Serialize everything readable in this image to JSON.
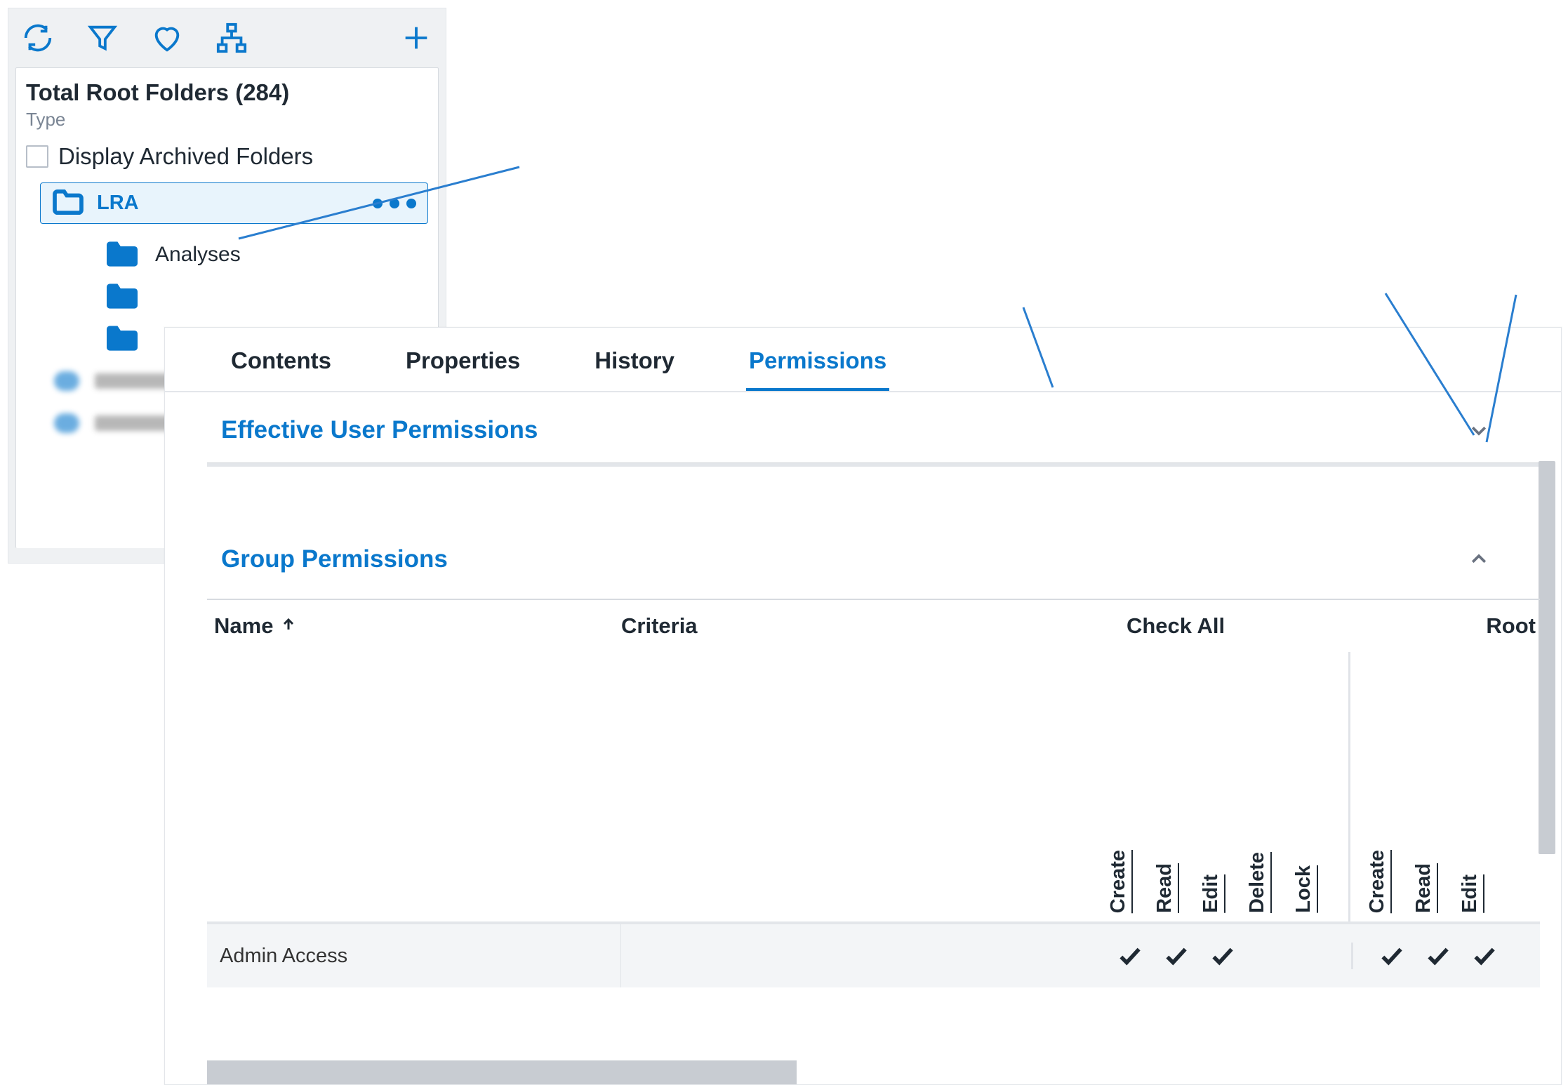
{
  "sidebar": {
    "root_header_prefix": "Total Root Folders",
    "root_header_count": "(284)",
    "root_subtitle": "Type",
    "archived_label": "Display Archived Folders",
    "selected_folder": "LRA",
    "subfolders": [
      "Analyses"
    ]
  },
  "tabs": {
    "contents": "Contents",
    "properties": "Properties",
    "history": "History",
    "permissions": "Permissions"
  },
  "sections": {
    "effective": "Effective User Permissions",
    "group": "Group Permissions"
  },
  "table": {
    "col_name": "Name",
    "col_criteria": "Criteria",
    "col_checkall": "Check All",
    "col_root": "Root",
    "perm_cols_main": [
      "Create",
      "Read",
      "Edit",
      "Delete",
      "Lock"
    ],
    "perm_cols_root": [
      "Create",
      "Read",
      "Edit"
    ],
    "rows": [
      {
        "name": "Admin Access",
        "criteria": "",
        "checks_main": [
          true,
          true,
          true,
          false,
          false
        ],
        "checks_root": [
          true,
          true,
          true
        ]
      }
    ]
  }
}
